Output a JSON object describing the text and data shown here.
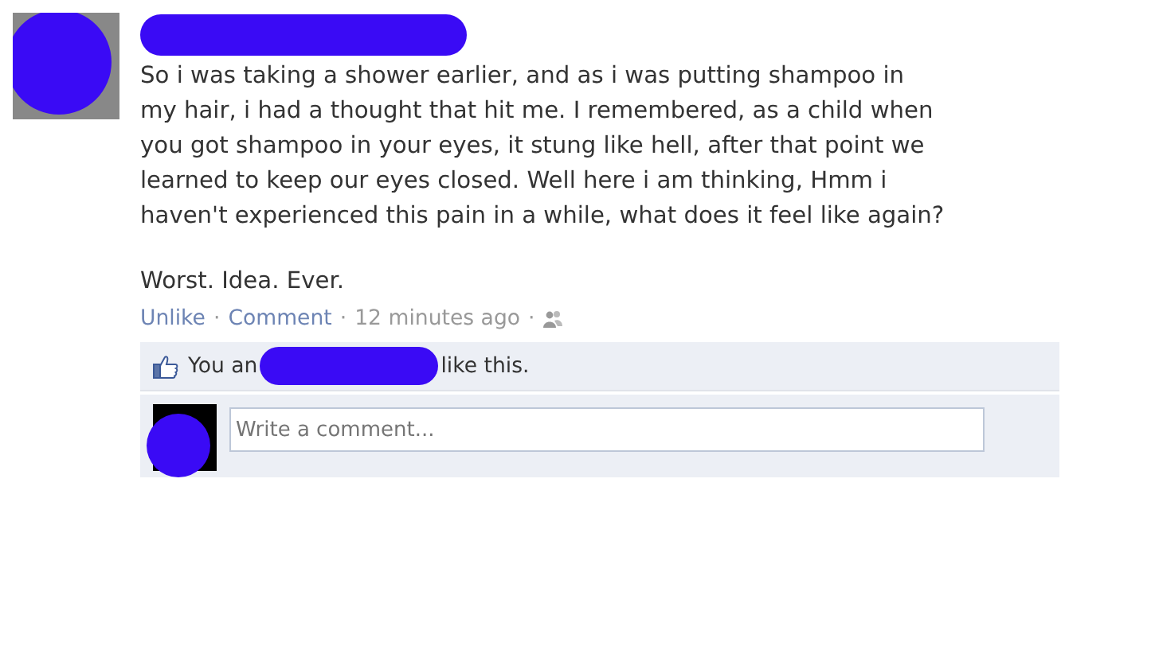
{
  "post": {
    "text": "So i was taking a shower earlier, and as i was putting shampoo in my hair, i had a thought that hit me. I remembered, as a child when you got shampoo in your eyes, it stung like hell, after that point we learned to keep our eyes closed. Well here i am thinking, Hmm i haven't experienced this pain in a while, what does it feel like again?",
    "closing": "Worst. Idea. Ever."
  },
  "actions": {
    "unlike": "Unlike",
    "separator": "·",
    "comment": "Comment",
    "time": "12 minutes ago"
  },
  "likes": {
    "prefix": "You an",
    "suffix": "like this."
  },
  "comment_box": {
    "placeholder": "Write a comment..."
  }
}
